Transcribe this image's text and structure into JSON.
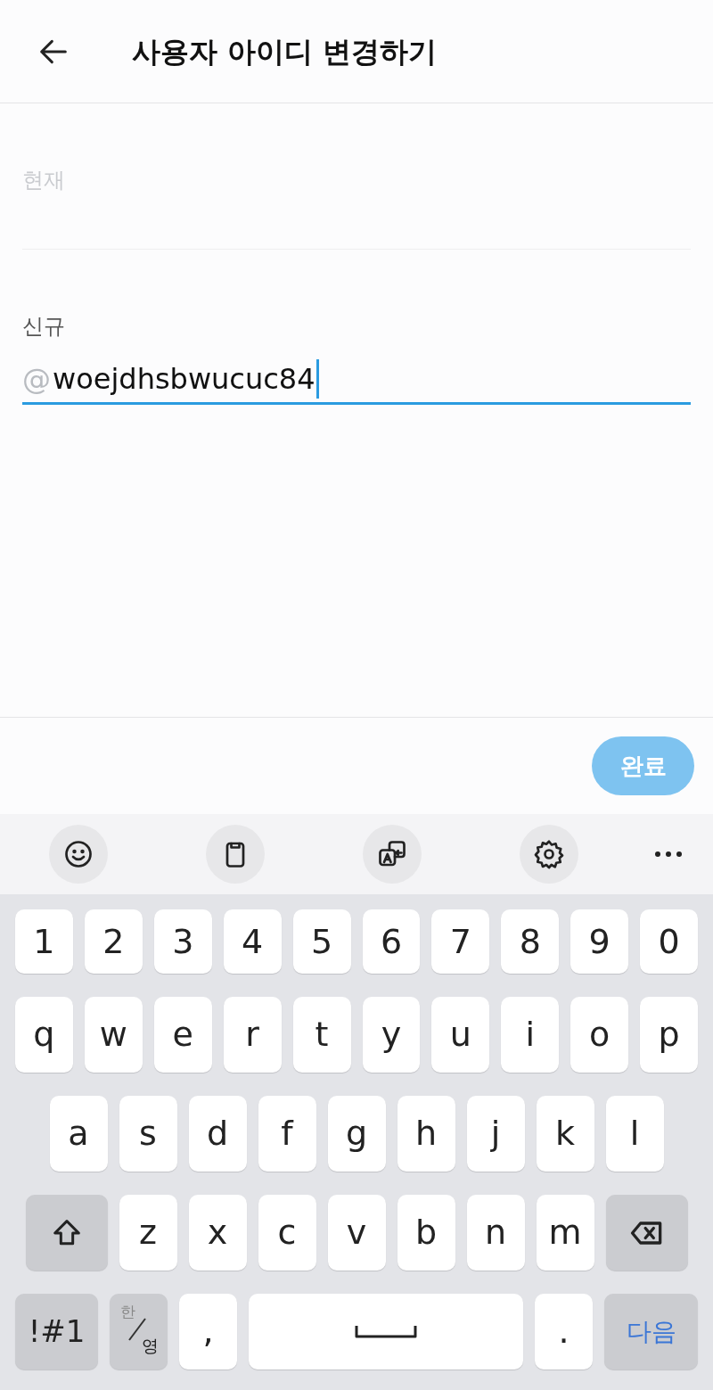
{
  "header": {
    "title": "사용자 아이디 변경하기"
  },
  "current": {
    "label": "현재"
  },
  "new": {
    "label": "신규",
    "prefix": "@",
    "value": "woejdhsbwucuc84",
    "focused": true
  },
  "done_button": {
    "label": "완료",
    "disabled": true
  },
  "keyboard": {
    "rows": [
      {
        "kind": "numbers",
        "keys": [
          {
            "kind": "char",
            "label": "1"
          },
          {
            "kind": "char",
            "label": "2"
          },
          {
            "kind": "char",
            "label": "3"
          },
          {
            "kind": "char",
            "label": "4"
          },
          {
            "kind": "char",
            "label": "5"
          },
          {
            "kind": "char",
            "label": "6"
          },
          {
            "kind": "char",
            "label": "7"
          },
          {
            "kind": "char",
            "label": "8"
          },
          {
            "kind": "char",
            "label": "9"
          },
          {
            "kind": "char",
            "label": "0"
          }
        ]
      },
      {
        "kind": "letters",
        "keys": [
          {
            "kind": "char",
            "label": "q"
          },
          {
            "kind": "char",
            "label": "w"
          },
          {
            "kind": "char",
            "label": "e"
          },
          {
            "kind": "char",
            "label": "r"
          },
          {
            "kind": "char",
            "label": "t"
          },
          {
            "kind": "char",
            "label": "y"
          },
          {
            "kind": "char",
            "label": "u"
          },
          {
            "kind": "char",
            "label": "i"
          },
          {
            "kind": "char",
            "label": "o"
          },
          {
            "kind": "char",
            "label": "p"
          }
        ]
      },
      {
        "kind": "letters",
        "keys": [
          {
            "kind": "char",
            "label": "a"
          },
          {
            "kind": "char",
            "label": "s"
          },
          {
            "kind": "char",
            "label": "d"
          },
          {
            "kind": "char",
            "label": "f"
          },
          {
            "kind": "char",
            "label": "g"
          },
          {
            "kind": "char",
            "label": "h"
          },
          {
            "kind": "char",
            "label": "j"
          },
          {
            "kind": "char",
            "label": "k"
          },
          {
            "kind": "char",
            "label": "l"
          }
        ]
      },
      {
        "kind": "letters",
        "keys": [
          {
            "kind": "shift"
          },
          {
            "kind": "char",
            "label": "z"
          },
          {
            "kind": "char",
            "label": "x"
          },
          {
            "kind": "char",
            "label": "c"
          },
          {
            "kind": "char",
            "label": "v"
          },
          {
            "kind": "char",
            "label": "b"
          },
          {
            "kind": "char",
            "label": "n"
          },
          {
            "kind": "char",
            "label": "m"
          },
          {
            "kind": "backspace"
          }
        ]
      },
      {
        "kind": "bottom",
        "keys": [
          {
            "kind": "symbols",
            "label": "!#1"
          },
          {
            "kind": "lang",
            "top": "한",
            "bottom": "영"
          },
          {
            "kind": "char",
            "label": ","
          },
          {
            "kind": "space"
          },
          {
            "kind": "char",
            "label": "."
          },
          {
            "kind": "action",
            "label": "다음"
          }
        ]
      }
    ]
  }
}
